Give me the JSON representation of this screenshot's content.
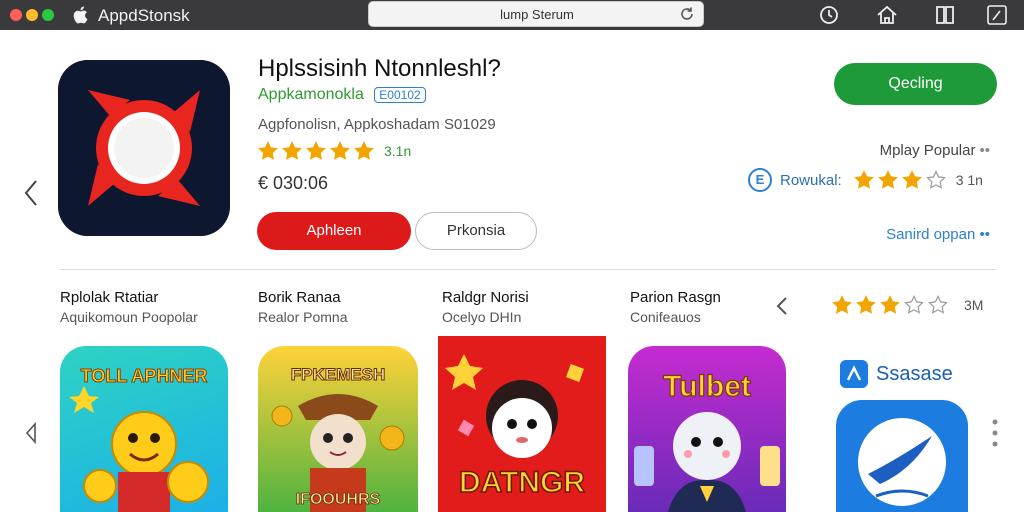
{
  "window": {
    "app_title": "AppdStonsk",
    "address": "lump Sterum"
  },
  "header_app": {
    "title": "Hplssisinh Ntonnleshl?",
    "developer": "Appkamonokla",
    "developer_badge": "E00102",
    "subline": "Agpfonolisn, Appkoshadam S01029",
    "stars": 5,
    "rating_text": "3.1n",
    "price": "€ 030:06",
    "primary_button": "Aphleen",
    "secondary_button": "Prkonsia",
    "get_button": "Qecling",
    "popular_label": "Mplay Popular",
    "popular_dots": "••",
    "review_badge": "E",
    "review_label": "Rowukal:",
    "review_stars": 3,
    "review_count": "3 1n",
    "see_all": "Sanird oppan",
    "see_all_dots": "••"
  },
  "cards": [
    {
      "title": "Rplolak Rtatiar",
      "subtitle": "Aquikomoun Poopolar"
    },
    {
      "title": "Borik Ranaa",
      "subtitle": "Realor Pomna"
    },
    {
      "title": "Raldgr Norisi",
      "subtitle": "Ocelyo DHIn"
    },
    {
      "title": "Parion Rasgn",
      "subtitle": "Conifeauos"
    }
  ],
  "tile_texts": [
    "TOLL APHNER",
    "FPKEMESH",
    "DATNGR",
    "Tulbet"
  ],
  "tile_bottom_text": "IFOOUHRS",
  "right_rating_count": "3M",
  "right_rating_stars": 3,
  "soon_label": "Ssasase",
  "colors": {
    "accent_red": "#dc1a1a",
    "accent_green": "#1f9a38",
    "link_blue": "#2d7fd0",
    "star": "#f2a400"
  }
}
